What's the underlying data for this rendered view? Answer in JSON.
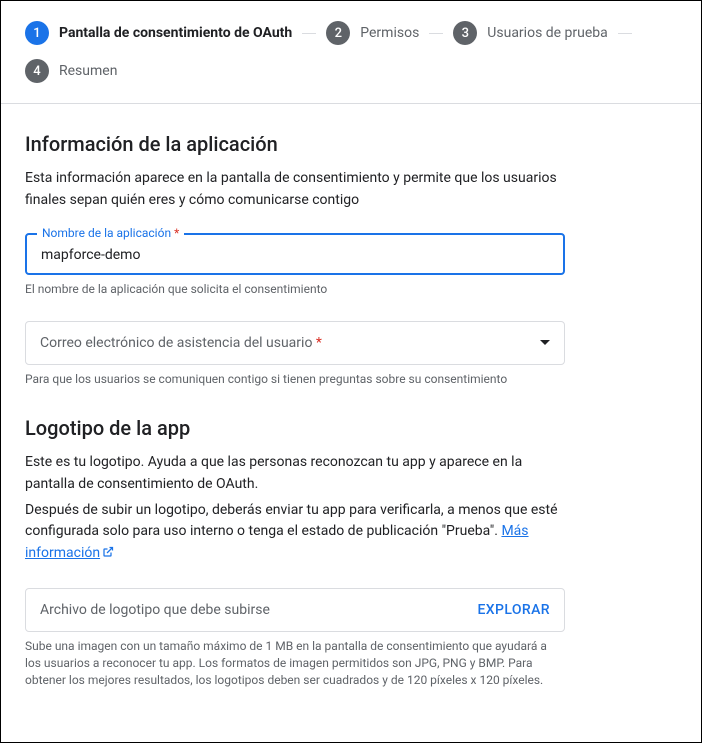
{
  "stepper": {
    "steps": [
      {
        "num": "1",
        "label": "Pantalla de consentimiento de OAuth"
      },
      {
        "num": "2",
        "label": "Permisos"
      },
      {
        "num": "3",
        "label": "Usuarios de prueba"
      },
      {
        "num": "4",
        "label": "Resumen"
      }
    ]
  },
  "appInfo": {
    "title": "Información de la aplicación",
    "desc": "Esta información aparece en la pantalla de consentimiento y permite que los usuarios finales sepan quién eres y cómo comunicarse contigo",
    "nameField": {
      "label": "Nombre de la aplicación",
      "required": "*",
      "value": "mapforce-demo",
      "helper": "El nombre de la aplicación que solicita el consentimiento"
    },
    "emailField": {
      "placeholder": "Correo electrónico de asistencia del usuario",
      "required": "*",
      "helper": "Para que los usuarios se comuniquen contigo si tienen preguntas sobre su consentimiento"
    }
  },
  "logo": {
    "title": "Logotipo de la app",
    "desc1": "Este es tu logotipo. Ayuda a que las personas reconozcan tu app y aparece en la pantalla de consentimiento de OAuth.",
    "desc2a": "Después de subir un logotipo, deberás enviar tu app para verificarla, a menos que esté configurada solo para uso interno o tenga el estado de publicación \"Prueba\". ",
    "linkText": "Más información",
    "uploadField": {
      "placeholder": "Archivo de logotipo que debe subirse",
      "button": "EXPLORAR",
      "helper": "Sube una imagen con un tamaño máximo de 1 MB en la pantalla de consentimiento que ayudará a los usuarios a reconocer tu app. Los formatos de imagen permitidos son JPG, PNG y BMP. Para obtener los mejores resultados, los logotipos deben ser cuadrados y de 120 píxeles x 120 píxeles."
    }
  }
}
